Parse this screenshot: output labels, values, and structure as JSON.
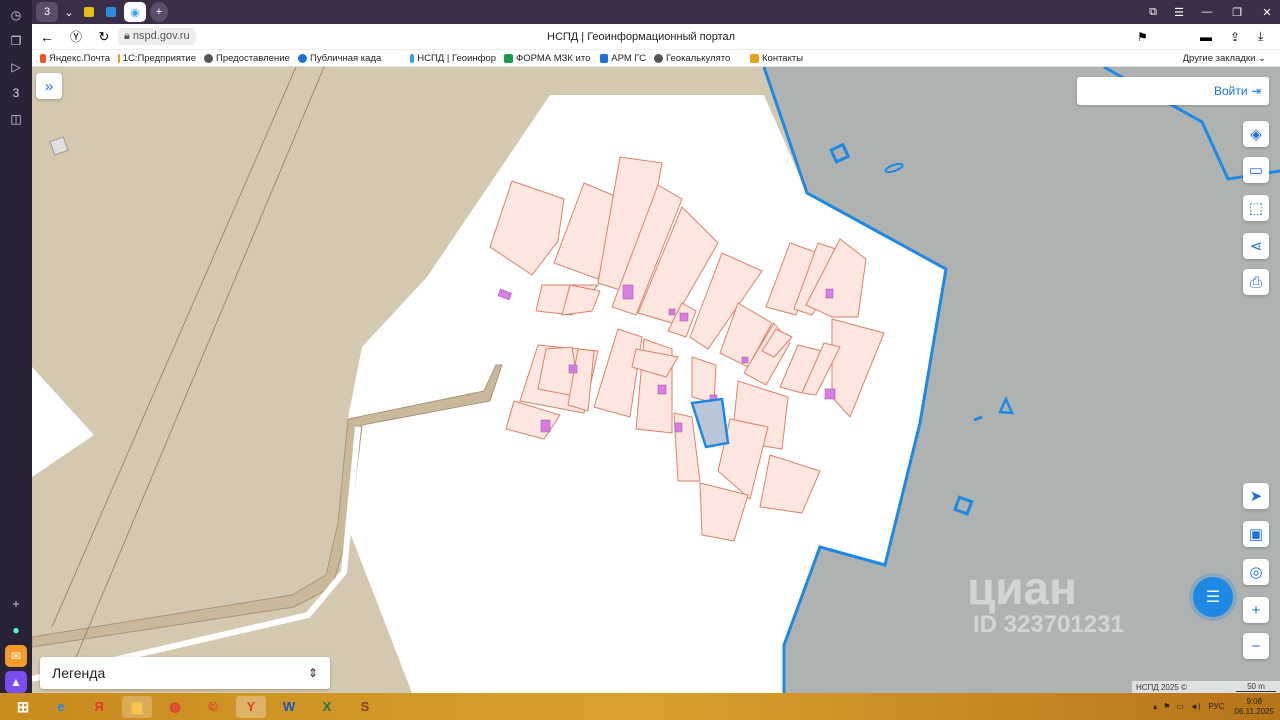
{
  "browser": {
    "tab_counter": "3",
    "page_title": "НСПД | Геоинформационный портал",
    "url": "nspd.gov.ru"
  },
  "bookmarks": [
    {
      "label": "Яндекс.Почта",
      "color": "#e8572a"
    },
    {
      "label": "1С:Предприятие",
      "color": "#e3a11a"
    },
    {
      "label": "Предоставление",
      "color": "#555"
    },
    {
      "label": "Публичная када",
      "color": "#1e6fd9"
    },
    {
      "label": "НСПД | Геоинфор",
      "color": "#3aa0e8"
    },
    {
      "label": "ФОРМА МЗК ито",
      "color": "#1a9a4a"
    },
    {
      "label": "АРМ ГС",
      "color": "#1e6fd9"
    },
    {
      "label": "Геокалькулято",
      "color": "#555"
    },
    {
      "label": "Контакты",
      "color": "#e3a11a"
    }
  ],
  "other_bookmarks": "Другие закладки",
  "map": {
    "login_label": "Войти",
    "legend_label": "Легенда",
    "watermark_brand": "циан",
    "watermark_id": "ID 323701231",
    "copyright": "НСПД 2025 ©",
    "scale_label": "50 m"
  },
  "tray": {
    "language": "РУС",
    "time": "9:08",
    "date": "06.11.2025"
  },
  "colors": {
    "water": "#aeb3b1",
    "land": "#d4c8b0",
    "parcel_fill": "#fce6df",
    "parcel_stroke": "#d9826a",
    "building": "#d77ce0",
    "selected": "#1e88e5",
    "boundary": "#1e88e5"
  }
}
